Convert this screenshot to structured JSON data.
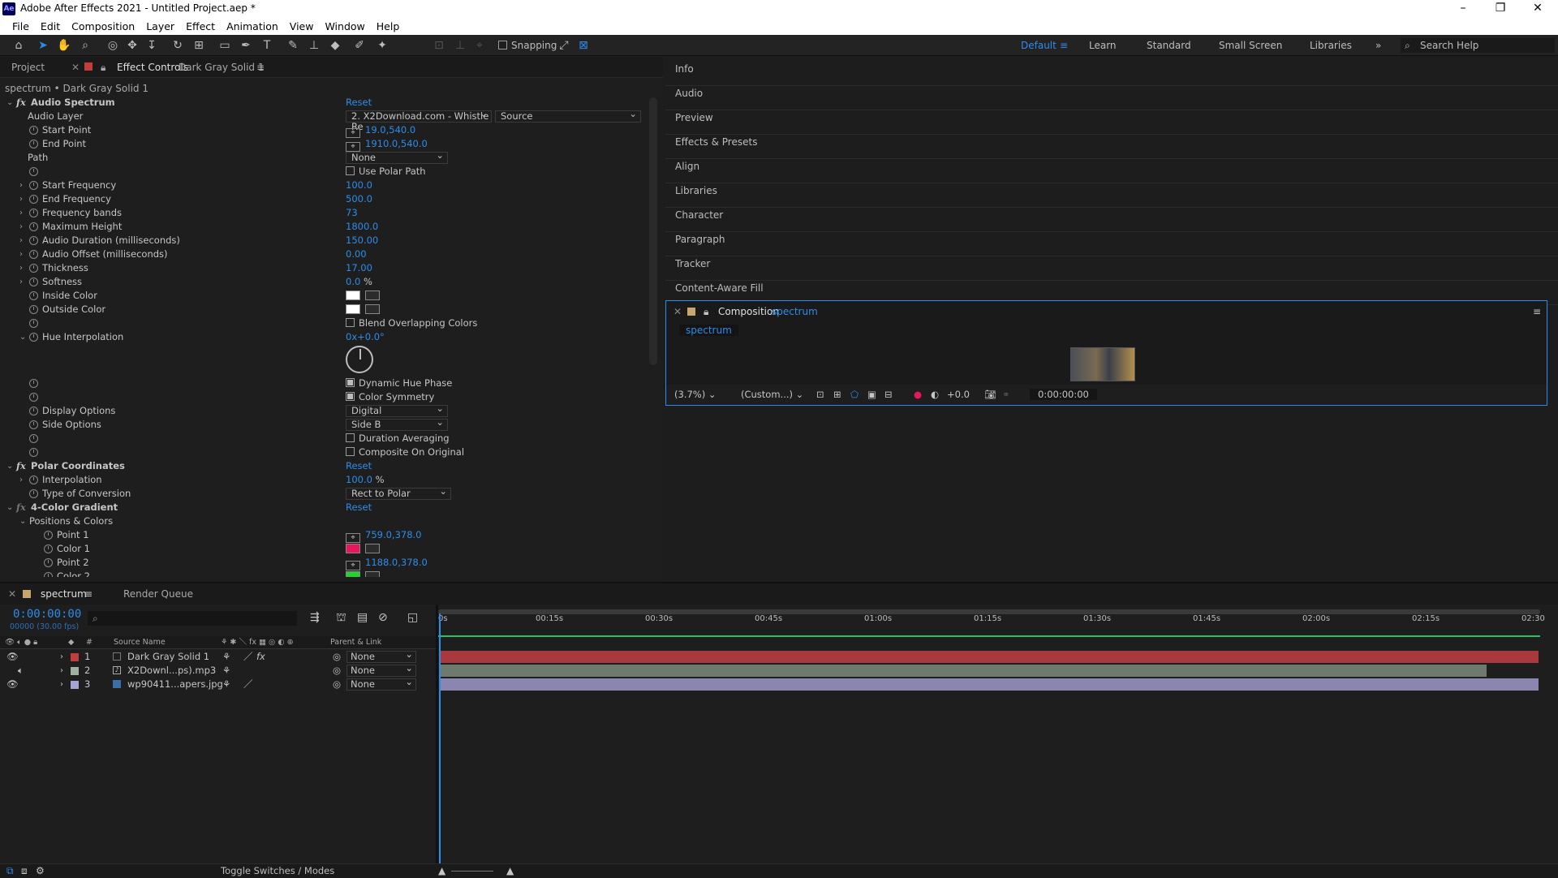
{
  "window": {
    "title": "Adobe After Effects 2021 - Untitled Project.aep *",
    "app_icon_text": "Ae",
    "controls": [
      "–",
      "❐",
      "✕"
    ]
  },
  "menu": [
    "File",
    "Edit",
    "Composition",
    "Layer",
    "Effect",
    "Animation",
    "View",
    "Window",
    "Help"
  ],
  "toolbar": {
    "snapping_label": "Snapping",
    "workspaces": [
      "Default",
      "Learn",
      "Standard",
      "Small Screen",
      "Libraries"
    ],
    "active_workspace": "Default",
    "search_placeholder": "Search Help"
  },
  "effect_panel": {
    "tab_project": "Project",
    "tab_effect_controls": "Effect Controls",
    "tab_layer": "Dark Gray Solid 1",
    "header": "spectrum • Dark Gray Solid 1",
    "reset_label": "Reset",
    "audio_spectrum": {
      "name": "Audio Spectrum",
      "audio_layer_label": "Audio Layer",
      "audio_layer_value": "2. X2Download.com - Whistle Re",
      "audio_layer_source": "Source",
      "start_point_label": "Start Point",
      "start_point": "19.0,540.0",
      "end_point_label": "End Point",
      "end_point": "1910.0,540.0",
      "path_label": "Path",
      "path_value": "None",
      "use_polar_path": "Use Polar Path",
      "start_frequency_label": "Start Frequency",
      "start_frequency": "100.0",
      "end_frequency_label": "End Frequency",
      "end_frequency": "500.0",
      "frequency_bands_label": "Frequency bands",
      "frequency_bands": "73",
      "maximum_height_label": "Maximum Height",
      "maximum_height": "1800.0",
      "audio_duration_label": "Audio Duration (milliseconds)",
      "audio_duration": "150.00",
      "audio_offset_label": "Audio Offset (milliseconds)",
      "audio_offset": "0.00",
      "thickness_label": "Thickness",
      "thickness": "17.00",
      "softness_label": "Softness",
      "softness": "0.0",
      "softness_unit": "%",
      "inside_color_label": "Inside Color",
      "inside_color": "#ffffff",
      "outside_color_label": "Outside Color",
      "outside_color": "#ffffff",
      "blend_overlapping": "Blend Overlapping Colors",
      "hue_interpolation_label": "Hue Interpolation",
      "hue_interpolation": "0x+0.0°",
      "dynamic_hue_phase": "Dynamic Hue Phase",
      "color_symmetry": "Color Symmetry",
      "display_options_label": "Display Options",
      "display_options": "Digital",
      "side_options_label": "Side Options",
      "side_options": "Side B",
      "duration_averaging": "Duration Averaging",
      "composite_on_original": "Composite On Original"
    },
    "polar_coordinates": {
      "name": "Polar Coordinates",
      "interpolation_label": "Interpolation",
      "interpolation": "100.0",
      "interpolation_unit": "%",
      "type_label": "Type of Conversion",
      "type_value": "Rect to Polar"
    },
    "four_color_gradient": {
      "name": "4-Color Gradient",
      "positions_colors": "Positions & Colors",
      "point1_label": "Point 1",
      "point1": "759.0,378.0",
      "color1_label": "Color 1",
      "color1": "#e8175d",
      "point2_label": "Point 2",
      "point2": "1188.0,378.0",
      "color2_label": "Color 2",
      "color2": "#22d32a"
    }
  },
  "right_panels": [
    "Info",
    "Audio",
    "Preview",
    "Effects & Presets",
    "Align",
    "Libraries",
    "Character",
    "Paragraph",
    "Tracker",
    "Content-Aware Fill"
  ],
  "composition": {
    "label": "Composition",
    "name": "spectrum",
    "tab": "spectrum",
    "zoom": "(3.7%)",
    "resolution": "(Custom...)",
    "exposure": "+0.0",
    "timecode": "0:00:00:00"
  },
  "timeline": {
    "tab": "spectrum",
    "render_queue": "Render Queue",
    "timecode": "0:00:00:00",
    "fps": "00000 (30.00 fps)",
    "search_placeholder": "",
    "col_source_name": "Source Name",
    "col_parent": "Parent & Link",
    "ruler": [
      "0s",
      "00:15s",
      "00:30s",
      "00:45s",
      "01:00s",
      "01:15s",
      "01:30s",
      "01:45s",
      "02:00s",
      "02:15s",
      "02:30"
    ],
    "layers": [
      {
        "num": "1",
        "name": "Dark Gray Solid 1",
        "label_color": "#c43d3d",
        "parent": "None",
        "bar_color": "#a8393c",
        "bar_end": 1.0
      },
      {
        "num": "2",
        "name": "X2Downl...ps).mp3",
        "label_color": "#9fb1a1",
        "parent": "None",
        "bar_color": "#6f7a6f",
        "bar_end": 0.953
      },
      {
        "num": "3",
        "name": "wp90411...apers.jpg",
        "label_color": "#a7a3d6",
        "parent": "None",
        "bar_color": "#8a86b0",
        "bar_end": 1.0
      }
    ],
    "toggle_label": "Toggle Switches / Modes"
  }
}
